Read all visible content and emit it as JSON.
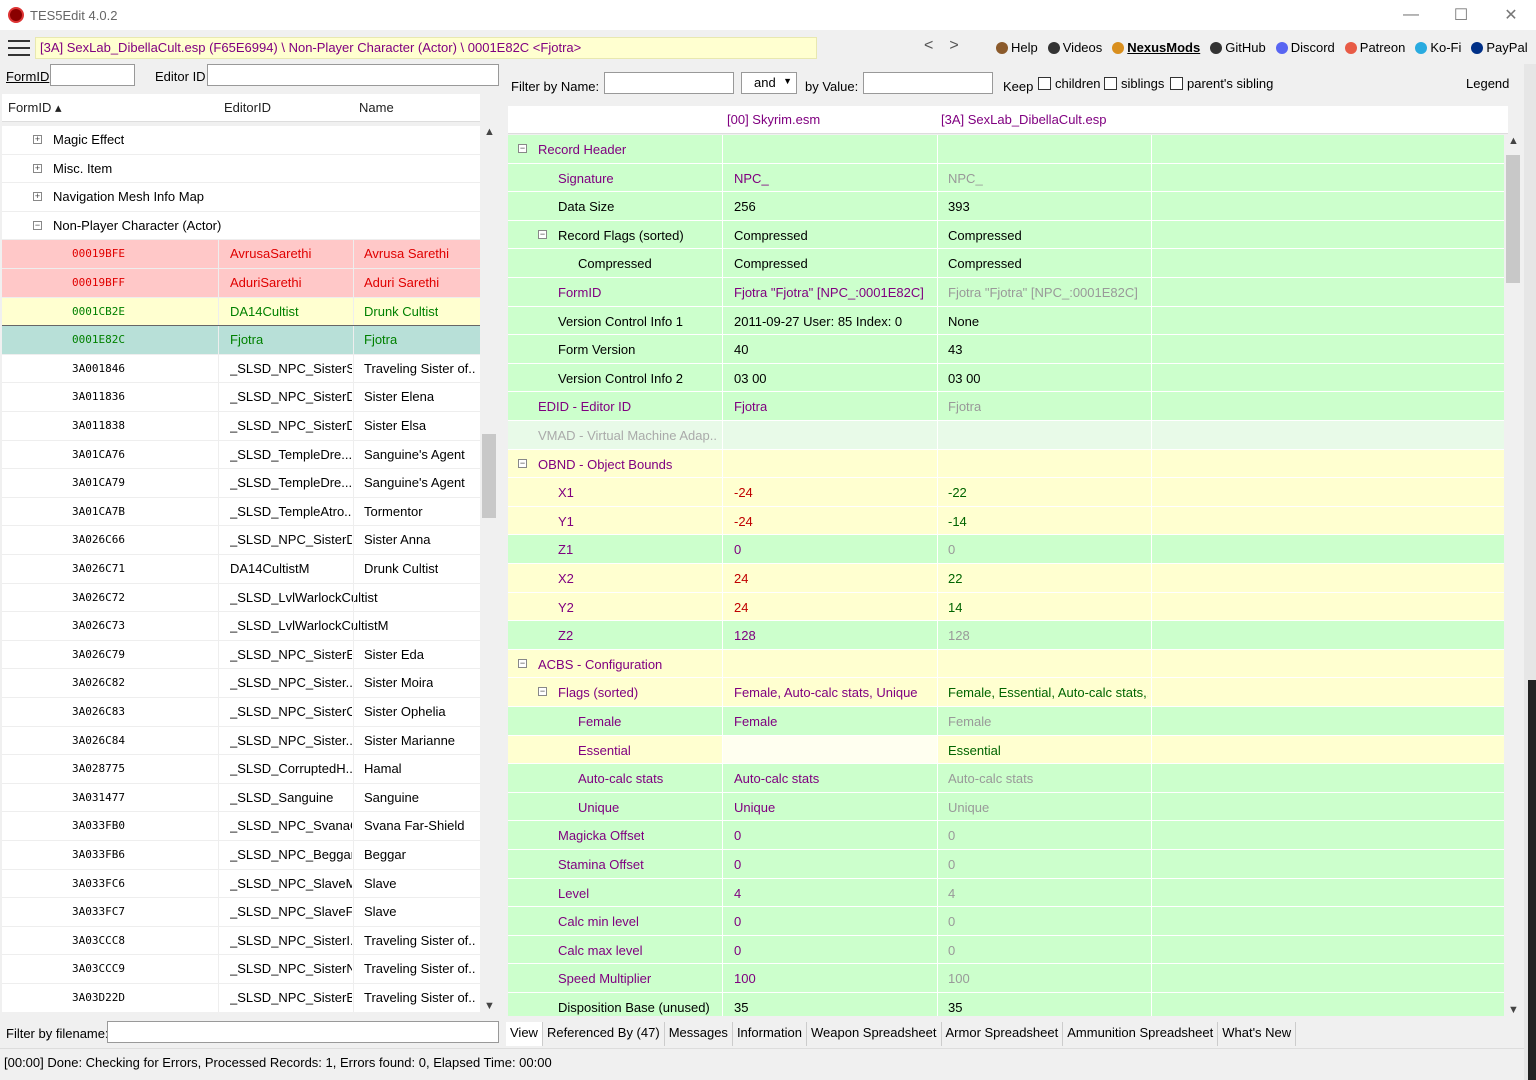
{
  "window": {
    "title": "TES5Edit 4.0.2",
    "min": "—",
    "max": "☐",
    "close": "✕"
  },
  "toolbar": {
    "path": "[3A] SexLab_DibellaCult.esp (F65E6994) \\ Non-Player Character (Actor) \\ 0001E82C <Fjotra>",
    "back": "<",
    "forward": ">",
    "links": [
      {
        "label": "Help",
        "icon": "book-icon",
        "color": "#8b5a2b"
      },
      {
        "label": "Videos",
        "icon": "video-icon",
        "color": "#333"
      },
      {
        "label": "NexusMods",
        "icon": "nexus-icon",
        "color": "#d98f1e",
        "bold": true
      },
      {
        "label": "GitHub",
        "icon": "github-icon",
        "color": "#333"
      },
      {
        "label": "Discord",
        "icon": "discord-icon",
        "color": "#5865f2"
      },
      {
        "label": "Patreon",
        "icon": "patreon-icon",
        "color": "#e85b46"
      },
      {
        "label": "Ko-Fi",
        "icon": "kofi-icon",
        "color": "#29abe0"
      },
      {
        "label": "PayPal",
        "icon": "paypal-icon",
        "color": "#003087"
      }
    ]
  },
  "left": {
    "formid_label": "FormID",
    "editorid_label": "Editor ID",
    "formid_value": "",
    "editorid_value": "",
    "cols": {
      "formid": "FormID",
      "editorid": "EditorID",
      "name": "Name"
    },
    "tree": [
      {
        "level": 1,
        "exp": "+",
        "label": "Magic Effect"
      },
      {
        "level": 1,
        "exp": "+",
        "label": "Misc. Item"
      },
      {
        "level": 1,
        "exp": "+",
        "label": "Navigation Mesh Info Map"
      },
      {
        "level": 1,
        "exp": "-",
        "label": "Non-Player Character (Actor)"
      },
      {
        "level": 2,
        "id": "00019BFE",
        "eid": "AvrusaSarethi",
        "name": "Avrusa Sarethi",
        "style": "red"
      },
      {
        "level": 2,
        "id": "00019BFF",
        "eid": "AduriSarethi",
        "name": "Aduri Sarethi",
        "style": "red"
      },
      {
        "level": 2,
        "id": "0001CB2E",
        "eid": "DA14Cultist",
        "name": "Drunk Cultist",
        "style": "yellow"
      },
      {
        "level": 2,
        "id": "0001E82C",
        "eid": "Fjotra",
        "name": "Fjotra",
        "style": "selected"
      },
      {
        "level": 2,
        "id": "3A001846",
        "eid": "_SLSD_NPC_SisterS...",
        "name": "Traveling Sister of..."
      },
      {
        "level": 2,
        "id": "3A011836",
        "eid": "_SLSD_NPC_SisterD...",
        "name": "Sister Elena"
      },
      {
        "level": 2,
        "id": "3A011838",
        "eid": "_SLSD_NPC_SisterD...",
        "name": "Sister Elsa"
      },
      {
        "level": 2,
        "id": "3A01CA76",
        "eid": "_SLSD_TempleDre...",
        "name": "Sanguine's Agent"
      },
      {
        "level": 2,
        "id": "3A01CA79",
        "eid": "_SLSD_TempleDre...",
        "name": "Sanguine's Agent"
      },
      {
        "level": 2,
        "id": "3A01CA7B",
        "eid": "_SLSD_TempleAtro...",
        "name": "Tormentor"
      },
      {
        "level": 2,
        "id": "3A026C66",
        "eid": "_SLSD_NPC_SisterD...",
        "name": "Sister Anna"
      },
      {
        "level": 2,
        "id": "3A026C71",
        "eid": "DA14CultistM",
        "name": "Drunk Cultist"
      },
      {
        "level": 2,
        "id": "3A026C72",
        "eid": "_SLSD_LvlWarlockCultist",
        "name": ""
      },
      {
        "level": 2,
        "id": "3A026C73",
        "eid": "_SLSD_LvlWarlockCultistM",
        "name": ""
      },
      {
        "level": 2,
        "id": "3A026C79",
        "eid": "_SLSD_NPC_SisterE...",
        "name": "Sister Eda"
      },
      {
        "level": 2,
        "id": "3A026C82",
        "eid": "_SLSD_NPC_Sister...",
        "name": "Sister Moira"
      },
      {
        "level": 2,
        "id": "3A026C83",
        "eid": "_SLSD_NPC_SisterO...",
        "name": "Sister Ophelia"
      },
      {
        "level": 2,
        "id": "3A026C84",
        "eid": "_SLSD_NPC_Sister...",
        "name": "Sister Marianne"
      },
      {
        "level": 2,
        "id": "3A028775",
        "eid": "_SLSD_CorruptedH...",
        "name": "Hamal"
      },
      {
        "level": 2,
        "id": "3A031477",
        "eid": "_SLSD_Sanguine",
        "name": "Sanguine"
      },
      {
        "level": 2,
        "id": "3A033FB0",
        "eid": "_SLSD_NPC_SvanaC...",
        "name": "Svana Far-Shield"
      },
      {
        "level": 2,
        "id": "3A033FB6",
        "eid": "_SLSD_NPC_Beggar...",
        "name": "Beggar"
      },
      {
        "level": 2,
        "id": "3A033FC6",
        "eid": "_SLSD_NPC_SlaveM...",
        "name": "Slave"
      },
      {
        "level": 2,
        "id": "3A033FC7",
        "eid": "_SLSD_NPC_SlaveF...",
        "name": "Slave"
      },
      {
        "level": 2,
        "id": "3A03CCC8",
        "eid": "_SLSD_NPC_SisterI...",
        "name": "Traveling Sister of..."
      },
      {
        "level": 2,
        "id": "3A03CCC9",
        "eid": "_SLSD_NPC_SisterN...",
        "name": "Traveling Sister of..."
      },
      {
        "level": 2,
        "id": "3A03D22D",
        "eid": "_SLSD_NPC_SisterB...",
        "name": "Traveling Sister of..."
      }
    ],
    "filter_label": "Filter by filename:",
    "filter_value": ""
  },
  "right": {
    "filter_name_label": "Filter by Name:",
    "andor": "and",
    "by_value_label": "by Value:",
    "keep_label": "Keep",
    "children": "children",
    "siblings": "siblings",
    "parents_sibling": "parent's sibling",
    "legend": "Legend",
    "col1": "[00] Skyrim.esm",
    "col2": "[3A] SexLab_DibellaCult.esp",
    "rows": [
      {
        "indent": 0,
        "exp": "-",
        "label": "Record Header",
        "v1": "",
        "v2": "",
        "bg": "green",
        "lc": "#800080",
        "c1": "#000",
        "c2": "#888"
      },
      {
        "indent": 1,
        "label": "Signature",
        "v1": "NPC_",
        "v2": "NPC_",
        "bg": "green",
        "lc": "#800080",
        "c1": "#800080",
        "c2": "#999"
      },
      {
        "indent": 1,
        "label": "Data Size",
        "v1": "256",
        "v2": "393",
        "bg": "green",
        "lc": "#000",
        "c1": "#000",
        "c2": "#000"
      },
      {
        "indent": 1,
        "exp": "-",
        "label": "Record Flags (sorted)",
        "v1": "Compressed",
        "v2": "Compressed",
        "bg": "green",
        "lc": "#000",
        "c1": "#000",
        "c2": "#000"
      },
      {
        "indent": 2,
        "label": "Compressed",
        "v1": "Compressed",
        "v2": "Compressed",
        "bg": "green",
        "lc": "#000",
        "c1": "#000",
        "c2": "#000"
      },
      {
        "indent": 1,
        "label": "FormID",
        "v1": "Fjotra \"Fjotra\" [NPC_:0001E82C]",
        "v2": "Fjotra \"Fjotra\" [NPC_:0001E82C]",
        "bg": "green",
        "lc": "#800080",
        "c1": "#800080",
        "c2": "#999"
      },
      {
        "indent": 1,
        "label": "Version Control Info 1",
        "v1": "2011-09-27 User: 85 Index: 0",
        "v2": "None",
        "bg": "green",
        "lc": "#000",
        "c1": "#000",
        "c2": "#000"
      },
      {
        "indent": 1,
        "label": "Form Version",
        "v1": "40",
        "v2": "43",
        "bg": "green",
        "lc": "#000",
        "c1": "#000",
        "c2": "#000"
      },
      {
        "indent": 1,
        "label": "Version Control Info 2",
        "v1": "03 00",
        "v2": "03 00",
        "bg": "green",
        "lc": "#000",
        "c1": "#000",
        "c2": "#000"
      },
      {
        "indent": 0,
        "label": "EDID - Editor ID",
        "v1": "Fjotra",
        "v2": "Fjotra",
        "bg": "green",
        "lc": "#800080",
        "c1": "#800080",
        "c2": "#999"
      },
      {
        "indent": 0,
        "label": "VMAD - Virtual Machine Adap...",
        "v1": "",
        "v2": "",
        "bg": "lightgreen",
        "lc": "#aaa",
        "c1": "#000",
        "c2": "#000"
      },
      {
        "indent": 0,
        "exp": "-",
        "label": "OBND - Object Bounds",
        "v1": "",
        "v2": "",
        "bg": "yellow",
        "lc": "#800080",
        "c1": "#000",
        "c2": "#000"
      },
      {
        "indent": 1,
        "label": "X1",
        "v1": "-24",
        "v2": "-22",
        "bg": "yellow",
        "lc": "#800080",
        "c1": "#c00000",
        "c2": "#006400"
      },
      {
        "indent": 1,
        "label": "Y1",
        "v1": "-24",
        "v2": "-14",
        "bg": "yellow",
        "lc": "#800080",
        "c1": "#c00000",
        "c2": "#006400"
      },
      {
        "indent": 1,
        "label": "Z1",
        "v1": "0",
        "v2": "0",
        "bg": "green",
        "lc": "#800080",
        "c1": "#800080",
        "c2": "#999"
      },
      {
        "indent": 1,
        "label": "X2",
        "v1": "24",
        "v2": "22",
        "bg": "yellow",
        "lc": "#800080",
        "c1": "#c00000",
        "c2": "#006400"
      },
      {
        "indent": 1,
        "label": "Y2",
        "v1": "24",
        "v2": "14",
        "bg": "yellow",
        "lc": "#800080",
        "c1": "#c00000",
        "c2": "#006400"
      },
      {
        "indent": 1,
        "label": "Z2",
        "v1": "128",
        "v2": "128",
        "bg": "green",
        "lc": "#800080",
        "c1": "#800080",
        "c2": "#999"
      },
      {
        "indent": 0,
        "exp": "-",
        "label": "ACBS - Configuration",
        "v1": "",
        "v2": "",
        "bg": "yellow",
        "lc": "#800080",
        "c1": "#000",
        "c2": "#000"
      },
      {
        "indent": 1,
        "exp": "-",
        "label": "Flags (sorted)",
        "v1": "Female, Auto-calc stats, Unique",
        "v2": "Female, Essential, Auto-calc stats,...",
        "bg": "yellow",
        "lc": "#800080",
        "c1": "#800080",
        "c2": "#006400"
      },
      {
        "indent": 2,
        "label": "Female",
        "v1": "Female",
        "v2": "Female",
        "bg": "green",
        "lc": "#800080",
        "c1": "#800080",
        "c2": "#999"
      },
      {
        "indent": 2,
        "label": "Essential",
        "v1": "",
        "v2": "Essential",
        "bg": "yellow",
        "lc": "#800080",
        "c1": "#000",
        "c2": "#006400",
        "v1bg": "#fffff0"
      },
      {
        "indent": 2,
        "label": "Auto-calc stats",
        "v1": "Auto-calc stats",
        "v2": "Auto-calc stats",
        "bg": "green",
        "lc": "#800080",
        "c1": "#800080",
        "c2": "#999"
      },
      {
        "indent": 2,
        "label": "Unique",
        "v1": "Unique",
        "v2": "Unique",
        "bg": "green",
        "lc": "#800080",
        "c1": "#800080",
        "c2": "#999"
      },
      {
        "indent": 1,
        "label": "Magicka Offset",
        "v1": "0",
        "v2": "0",
        "bg": "green",
        "lc": "#800080",
        "c1": "#800080",
        "c2": "#999"
      },
      {
        "indent": 1,
        "label": "Stamina Offset",
        "v1": "0",
        "v2": "0",
        "bg": "green",
        "lc": "#800080",
        "c1": "#800080",
        "c2": "#999"
      },
      {
        "indent": 1,
        "label": "Level",
        "v1": "4",
        "v2": "4",
        "bg": "green",
        "lc": "#800080",
        "c1": "#800080",
        "c2": "#999"
      },
      {
        "indent": 1,
        "label": "Calc min level",
        "v1": "0",
        "v2": "0",
        "bg": "green",
        "lc": "#800080",
        "c1": "#800080",
        "c2": "#999"
      },
      {
        "indent": 1,
        "label": "Calc max level",
        "v1": "0",
        "v2": "0",
        "bg": "green",
        "lc": "#800080",
        "c1": "#800080",
        "c2": "#999"
      },
      {
        "indent": 1,
        "label": "Speed Multiplier",
        "v1": "100",
        "v2": "100",
        "bg": "green",
        "lc": "#800080",
        "c1": "#800080",
        "c2": "#999"
      },
      {
        "indent": 1,
        "label": "Disposition Base (unused)",
        "v1": "35",
        "v2": "35",
        "bg": "green",
        "lc": "#000",
        "c1": "#000",
        "c2": "#000"
      }
    ]
  },
  "tabs": [
    "View",
    "Referenced By (47)",
    "Messages",
    "Information",
    "Weapon Spreadsheet",
    "Armor Spreadsheet",
    "Ammunition Spreadsheet",
    "What's New"
  ],
  "status": "[00:00] Done: Checking for Errors, Processed Records: 1, Errors found: 0, Elapsed Time: 00:00",
  "colors": {
    "green": "#ccffcc",
    "lightgreen": "#e8fae8",
    "yellow": "#ffffd0",
    "red": "#ffc8c8",
    "selected": "#b8e0d8"
  }
}
